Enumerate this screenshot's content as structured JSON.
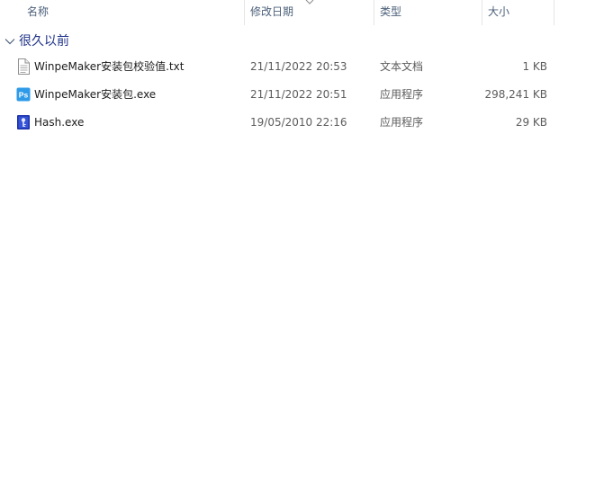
{
  "columns": {
    "name": "名称",
    "date": "修改日期",
    "type": "类型",
    "size": "大小"
  },
  "group": {
    "label": "很久以前"
  },
  "files": [
    {
      "name": "WinpeMaker安装包校验值.txt",
      "date": "21/11/2022 20:53",
      "type": "文本文档",
      "size": "1 KB",
      "icon": "text-file-icon"
    },
    {
      "name": "WinpeMaker安装包.exe",
      "date": "21/11/2022 20:51",
      "type": "应用程序",
      "size": "298,241 KB",
      "icon": "ps-app-icon"
    },
    {
      "name": "Hash.exe",
      "date": "19/05/2010 22:16",
      "type": "应用程序",
      "size": "29 KB",
      "icon": "hash-app-icon"
    }
  ],
  "colors": {
    "header_text": "#4c607a",
    "group_text": "#1e3287",
    "ps_icon": "#2f9be8"
  }
}
